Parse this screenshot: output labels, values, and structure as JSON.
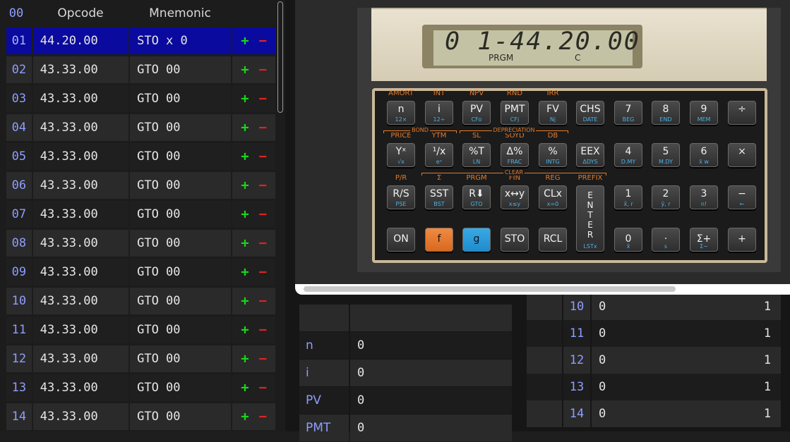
{
  "program": {
    "headers": {
      "step": "00",
      "opcode": "Opcode",
      "mnemonic": "Mnemonic"
    },
    "plus": "+",
    "minus": "−",
    "rows": [
      {
        "step": "01",
        "opcode": "44.20.00",
        "mnemonic": "STO x 0",
        "selected": true
      },
      {
        "step": "02",
        "opcode": "43.33.00",
        "mnemonic": "GTO 00"
      },
      {
        "step": "03",
        "opcode": "43.33.00",
        "mnemonic": "GTO 00"
      },
      {
        "step": "04",
        "opcode": "43.33.00",
        "mnemonic": "GTO 00"
      },
      {
        "step": "05",
        "opcode": "43.33.00",
        "mnemonic": "GTO 00"
      },
      {
        "step": "06",
        "opcode": "43.33.00",
        "mnemonic": "GTO 00"
      },
      {
        "step": "07",
        "opcode": "43.33.00",
        "mnemonic": "GTO 00"
      },
      {
        "step": "08",
        "opcode": "43.33.00",
        "mnemonic": "GTO 00"
      },
      {
        "step": "09",
        "opcode": "43.33.00",
        "mnemonic": "GTO 00"
      },
      {
        "step": "10",
        "opcode": "43.33.00",
        "mnemonic": "GTO 00"
      },
      {
        "step": "11",
        "opcode": "43.33.00",
        "mnemonic": "GTO 00"
      },
      {
        "step": "12",
        "opcode": "43.33.00",
        "mnemonic": "GTO 00"
      },
      {
        "step": "13",
        "opcode": "43.33.00",
        "mnemonic": "GTO 00"
      },
      {
        "step": "14",
        "opcode": "43.33.00",
        "mnemonic": "GTO 00"
      }
    ]
  },
  "registers": [
    {
      "name": "",
      "value": ""
    },
    {
      "name": "n",
      "value": "0"
    },
    {
      "name": "i",
      "value": "0"
    },
    {
      "name": "PV",
      "value": "0"
    },
    {
      "name": "PMT",
      "value": "0"
    }
  ],
  "storage": [
    {
      "reg": "10",
      "value": "0",
      "flag": "1"
    },
    {
      "reg": "11",
      "value": "0",
      "flag": "1"
    },
    {
      "reg": "12",
      "value": "0",
      "flag": "1"
    },
    {
      "reg": "13",
      "value": "0",
      "flag": "1"
    },
    {
      "reg": "14",
      "value": "0",
      "flag": "1"
    }
  ],
  "display": {
    "text": "0 1-44.20.00",
    "prgm": "PRGM",
    "c": "C"
  },
  "keypad": {
    "rows": [
      [
        {
          "top": "AMORT",
          "main": "n",
          "bottom": "12×"
        },
        {
          "top": "INT",
          "main": "i",
          "bottom": "12÷"
        },
        {
          "top": "NPV",
          "main": "PV",
          "bottom": "CFo"
        },
        {
          "top": "RND",
          "main": "PMT",
          "bottom": "CFj"
        },
        {
          "top": "IRR",
          "main": "FV",
          "bottom": "Nj"
        },
        {
          "top": "",
          "main": "CHS",
          "bottom": "DATE"
        },
        {
          "top": "",
          "main": "7",
          "bottom": "BEG"
        },
        {
          "top": "",
          "main": "8",
          "bottom": "END"
        },
        {
          "top": "",
          "main": "9",
          "bottom": "MEM"
        },
        {
          "top": "",
          "main": "÷",
          "bottom": ""
        }
      ],
      [
        {
          "top": "PRICE",
          "main": "Yˣ",
          "bottom": "√x"
        },
        {
          "top": "YTM",
          "main": "¹/x",
          "bottom": "eˣ"
        },
        {
          "top": "SL",
          "main": "%T",
          "bottom": "LN"
        },
        {
          "top": "SOYD",
          "main": "Δ%",
          "bottom": "FRAC"
        },
        {
          "top": "DB",
          "main": "%",
          "bottom": "INTG"
        },
        {
          "top": "",
          "main": "EEX",
          "bottom": "ΔDYS"
        },
        {
          "top": "",
          "main": "4",
          "bottom": "D.MY"
        },
        {
          "top": "",
          "main": "5",
          "bottom": "M.DY"
        },
        {
          "top": "",
          "main": "6",
          "bottom": "x̄ w"
        },
        {
          "top": "",
          "main": "×",
          "bottom": ""
        }
      ],
      [
        {
          "top": "P/R",
          "main": "R/S",
          "bottom": "PSE"
        },
        {
          "top": "Σ",
          "main": "SST",
          "bottom": "BST"
        },
        {
          "top": "PRGM",
          "main": "R⬇",
          "bottom": "GTO"
        },
        {
          "top": "FIN",
          "main": "x↔y",
          "bottom": "x≤y"
        },
        {
          "top": "REG",
          "main": "CLx",
          "bottom": "x=0"
        },
        {
          "top": "PREFIX",
          "main": "",
          "bottom": ""
        },
        {
          "top": "",
          "main": "1",
          "bottom": "x̂, r"
        },
        {
          "top": "",
          "main": "2",
          "bottom": "ŷ, r"
        },
        {
          "top": "",
          "main": "3",
          "bottom": "n!"
        },
        {
          "top": "",
          "main": "−",
          "bottom": "←"
        }
      ],
      [
        {
          "top": "",
          "main": "ON",
          "bottom": ""
        },
        {
          "top": "",
          "main": "f",
          "bottom": ""
        },
        {
          "top": "",
          "main": "g",
          "bottom": ""
        },
        {
          "top": "",
          "main": "STO",
          "bottom": ""
        },
        {
          "top": "",
          "main": "RCL",
          "bottom": ""
        },
        {
          "top": "",
          "main": "",
          "bottom": ""
        },
        {
          "top": "",
          "main": "0",
          "bottom": "x̄"
        },
        {
          "top": "",
          "main": "·",
          "bottom": "s"
        },
        {
          "top": "",
          "main": "Σ+",
          "bottom": "Σ−"
        },
        {
          "top": "",
          "main": "+",
          "bottom": ""
        }
      ]
    ],
    "enter": {
      "main": "E\nN\nT\nE\nR",
      "bottom": "LSTx"
    },
    "groups": {
      "bond": "BOND",
      "depreciation": "DEPRECIATION",
      "clear": "CLEAR"
    }
  },
  "colors": {
    "selected_row": "#0a0a9e",
    "plus": "#19d619",
    "minus": "#e22222",
    "f_key": "#e8772e",
    "g_key": "#2a9cdc",
    "step_number": "#8f9dff"
  }
}
